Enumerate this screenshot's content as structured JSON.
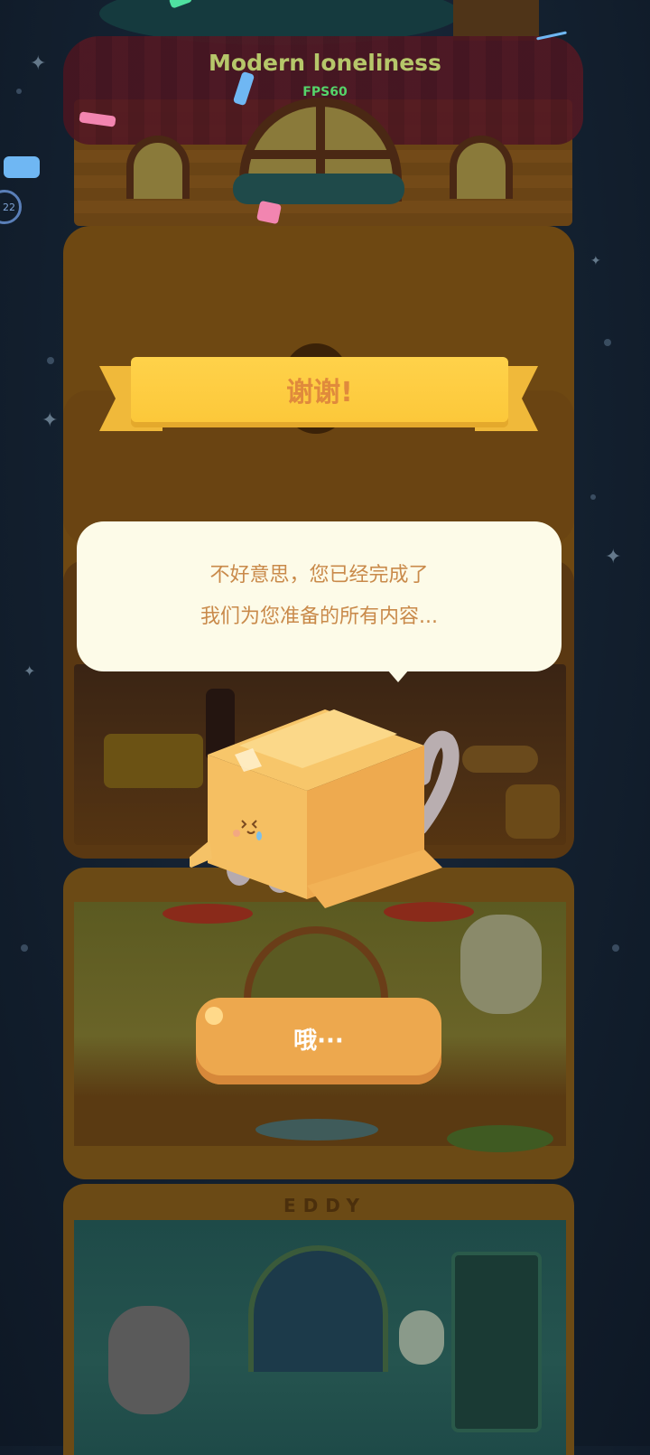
{
  "header": {
    "title": "Modern loneliness",
    "fps": "FPS60"
  },
  "side": {
    "badge_text": "22"
  },
  "banner": {
    "text": "谢谢!"
  },
  "dialog": {
    "line1": "不好意思，您已经完成了",
    "line2": "我们为您准备的所有内容..."
  },
  "button": {
    "label": "哦···"
  },
  "room_sign": {
    "text": "EDDY"
  },
  "colors": {
    "background": "#13202f",
    "banner": "#fcc83a",
    "banner_text": "#e08a3c",
    "bubble": "#fdfbe8",
    "bubble_text": "#c98a4a",
    "button": "#eda84e",
    "title": "#b6c76a",
    "fps": "#55d46a"
  },
  "icons": {
    "mascot": "cat-in-cardboard-box-icon"
  }
}
